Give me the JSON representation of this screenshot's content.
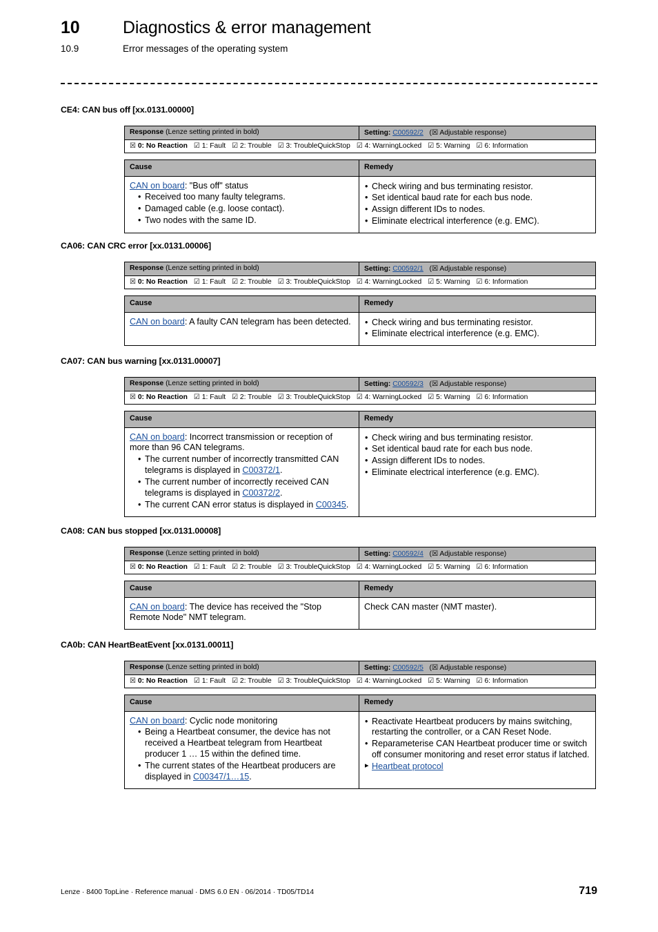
{
  "header": {
    "chapter_number": "10",
    "chapter_title": "Diagnostics & error management",
    "section_number": "10.9",
    "section_title": "Error messages of the operating system"
  },
  "common": {
    "response_label": "Response",
    "response_note": "(Lenze setting printed in bold)",
    "setting_label": "Setting:",
    "adjustable_response": "(☒ Adjustable response)",
    "cause_header": "Cause",
    "remedy_header": "Remedy",
    "can_on_board": "CAN on board",
    "options": [
      {
        "box": "☒",
        "label": "0: No Reaction",
        "bold": true
      },
      {
        "box": "☑",
        "label": "1: Fault",
        "bold": false
      },
      {
        "box": "☑",
        "label": "2: Trouble",
        "bold": false
      },
      {
        "box": "☑",
        "label": "3: TroubleQuickStop",
        "bold": false
      },
      {
        "box": "☑",
        "label": "4: WarningLocked",
        "bold": false
      },
      {
        "box": "☑",
        "label": "5: Warning",
        "bold": false
      },
      {
        "box": "☑",
        "label": "6: Information",
        "bold": false
      }
    ]
  },
  "blocks": [
    {
      "title": "CE4: CAN bus off [xx.0131.00000]",
      "setting_code": "C00592/2",
      "cause_intro_suffix": ": \"Bus off\" status",
      "cause_bullets": [
        "Received too many faulty telegrams.",
        "Damaged cable (e.g. loose contact).",
        "Two nodes with the same ID."
      ],
      "remedies": [
        "Check wiring and bus terminating resistor.",
        "Set identical baud rate for each bus node.",
        "Assign different IDs to nodes.",
        "Eliminate electrical interference (e.g. EMC)."
      ]
    },
    {
      "title": "CA06: CAN CRC error [xx.0131.00006]",
      "setting_code": "C00592/1",
      "cause_intro_suffix": ": A faulty CAN telegram has been detected.",
      "cause_bullets": [],
      "remedies": [
        "Check wiring and bus terminating resistor.",
        "Eliminate electrical interference (e.g. EMC)."
      ]
    },
    {
      "title": "CA07: CAN bus warning [xx.0131.00007]",
      "setting_code": "C00592/3",
      "cause_intro_suffix": ": Incorrect transmission or reception of more than 96 CAN telegrams.",
      "cause_bullets_rich": [
        {
          "pre": "The current number of incorrectly transmitted CAN telegrams is displayed in ",
          "link": "C00372/1",
          "post": "."
        },
        {
          "pre": "The current number of incorrectly received CAN telegrams is displayed in ",
          "link": "C00372/2",
          "post": "."
        },
        {
          "pre": "The current CAN error status is displayed in ",
          "link": "C00345",
          "post": "."
        }
      ],
      "remedies": [
        "Check wiring and bus terminating resistor.",
        "Set identical baud rate for each bus node.",
        "Assign different IDs to nodes.",
        "Eliminate electrical interference (e.g. EMC)."
      ]
    },
    {
      "title": "CA08: CAN bus stopped [xx.0131.00008]",
      "setting_code": "C00592/4",
      "cause_intro_suffix": ": The device has received the \"Stop Remote Node\" NMT telegram.",
      "cause_bullets": [],
      "remedies_plain": "Check CAN master (NMT master)."
    },
    {
      "title": "CA0b: CAN HeartBeatEvent [xx.0131.00011]",
      "setting_code": "C00592/5",
      "cause_intro_suffix": ": Cyclic node monitoring",
      "cause_bullets_rich": [
        {
          "pre": "Being a Heartbeat consumer, the device has not received a Heartbeat telegram from Heartbeat producer 1 … 15 within the defined time.",
          "link": "",
          "post": ""
        },
        {
          "pre": "The current states of the Heartbeat producers are displayed in ",
          "link": "C00347/1…15",
          "post": "."
        }
      ],
      "remedies": [
        "Reactivate Heartbeat producers by mains switching, restarting the controller, or a CAN Reset Node.",
        "Reparameterise CAN Heartbeat producer time or switch off consumer monitoring and reset error status if latched."
      ],
      "remedy_link": "Heartbeat protocol"
    }
  ],
  "footer": {
    "text": "Lenze · 8400 TopLine · Reference manual · DMS 6.0 EN · 06/2014 · TD05/TD14",
    "page_number": "719"
  }
}
